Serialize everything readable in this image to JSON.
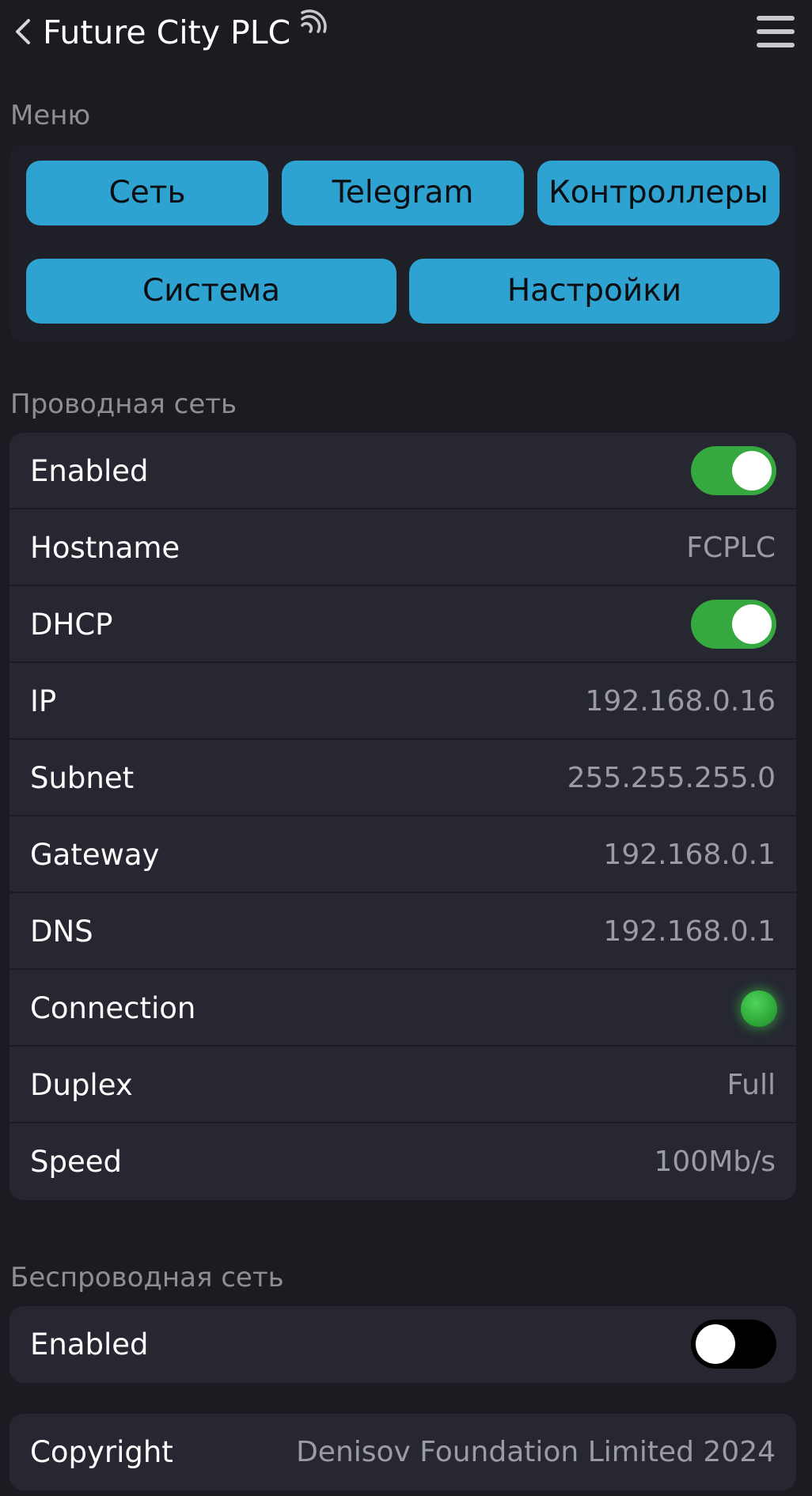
{
  "header": {
    "title": "Future City PLC"
  },
  "menu": {
    "section_title": "Меню",
    "buttons": [
      "Сеть",
      "Telegram",
      "Контроллеры",
      "Система",
      "Настройки"
    ]
  },
  "wired": {
    "section_title": "Проводная сеть",
    "enabled_label": "Enabled",
    "enabled": true,
    "hostname_label": "Hostname",
    "hostname": "FCPLC",
    "dhcp_label": "DHCP",
    "dhcp": true,
    "ip_label": "IP",
    "ip": "192.168.0.16",
    "subnet_label": "Subnet",
    "subnet": "255.255.255.0",
    "gateway_label": "Gateway",
    "gateway": "192.168.0.1",
    "dns_label": "DNS",
    "dns": "192.168.0.1",
    "connection_label": "Connection",
    "connection_color": "#35a83f",
    "duplex_label": "Duplex",
    "duplex": "Full",
    "speed_label": "Speed",
    "speed": "100Mb/s"
  },
  "wireless": {
    "section_title": "Беспроводная сеть",
    "enabled_label": "Enabled",
    "enabled": false
  },
  "footer": {
    "copyright_label": "Copyright",
    "copyright_value": "Denisov Foundation Limited 2024"
  },
  "colors": {
    "background": "#1b1c22",
    "card": "#262731",
    "accent": "#2ea3d1",
    "toggle_on": "#35a83f"
  }
}
